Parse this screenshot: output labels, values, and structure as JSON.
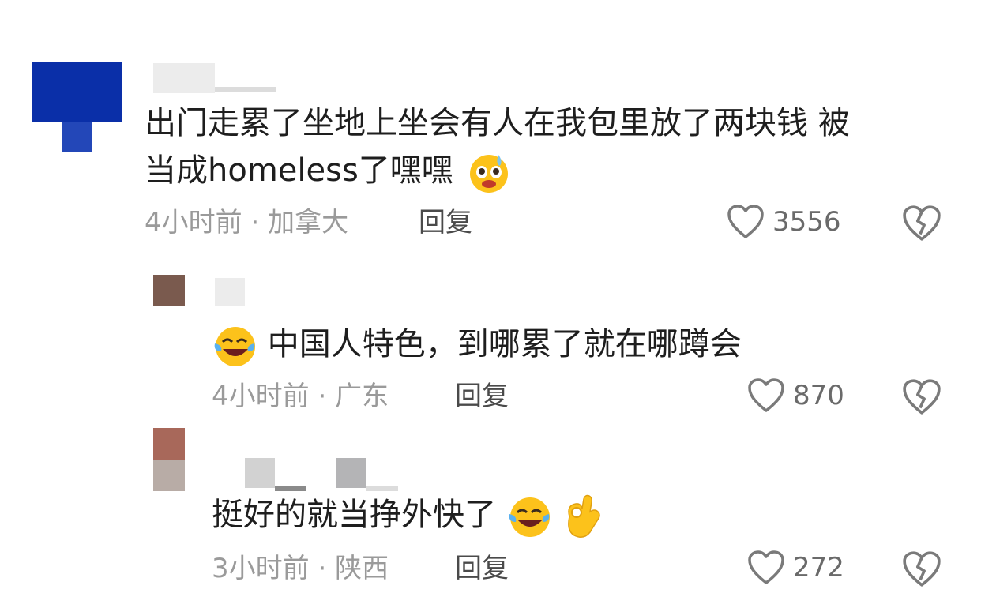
{
  "comments": [
    {
      "text_line1": "出门走累了坐地上坐会有人在我包里放了两块钱 被",
      "text_line2": "当成homeless了嘿嘿",
      "time": "4小时前",
      "location": "加拿大",
      "reply_label": "回复",
      "likes": "3556",
      "emojis": [
        "sweating-face-emoji"
      ]
    },
    {
      "text": "中国人特色，到哪累了就在哪蹲会",
      "time": "4小时前",
      "location": "广东",
      "reply_label": "回复",
      "likes": "870",
      "emojis": [
        "laughing-tears-emoji"
      ]
    },
    {
      "text": "挺好的就当挣外快了",
      "time": "3小时前",
      "location": "陕西",
      "reply_label": "回复",
      "likes": "272",
      "emojis": [
        "laughing-tears-emoji",
        "ok-hand-emoji"
      ]
    }
  ],
  "separator": "·",
  "colors": {
    "avatar1_blue": "#0a2fa8",
    "avatar2_brown": "#7a5a4e",
    "avatar3_top": "#a8685a",
    "avatar3_bottom": "#b8aca6",
    "meta_gray": "#9a9a9a",
    "text": "#1e1e1e"
  }
}
